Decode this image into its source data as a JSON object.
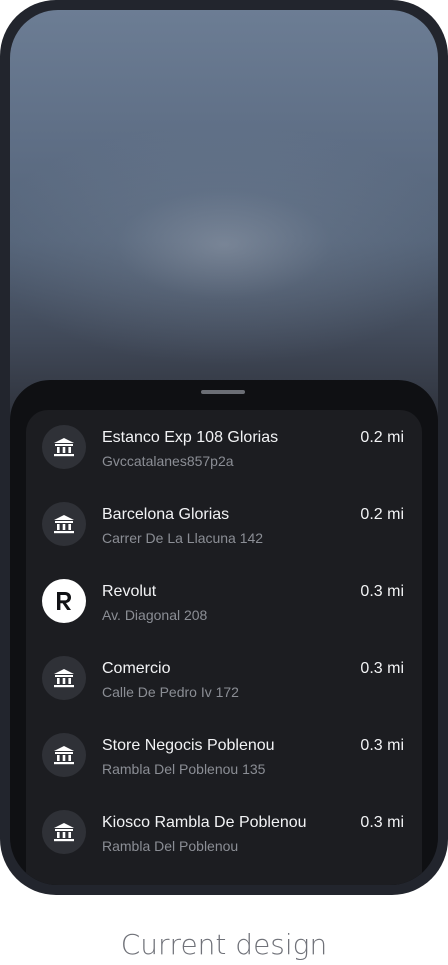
{
  "locations": [
    {
      "name": "Estanco Exp 108 Glorias",
      "address": "Gvccatalanes857p2a",
      "distance": "0.2 mi",
      "icon": "bank-icon"
    },
    {
      "name": "Barcelona Glorias",
      "address": "Carrer De La Llacuna 142",
      "distance": "0.2 mi",
      "icon": "bank-icon"
    },
    {
      "name": "Revolut",
      "address": "Av. Diagonal 208",
      "distance": "0.3 mi",
      "icon": "revolut-logo-icon"
    },
    {
      "name": "Comercio",
      "address": "Calle De Pedro Iv 172",
      "distance": "0.3 mi",
      "icon": "bank-icon"
    },
    {
      "name": "Store Negocis Poblenou",
      "address": "Rambla Del Poblenou 135",
      "distance": "0.3 mi",
      "icon": "bank-icon"
    },
    {
      "name": "Kiosco Rambla De Poblenou",
      "address": "Rambla Del Poblenou",
      "distance": "0.3 mi",
      "icon": "bank-icon"
    }
  ],
  "caption": "Current design",
  "colors": {
    "sheet_bg": "#0f1013",
    "card_bg": "#1c1d21",
    "icon_bg": "#2f3137",
    "primary_text": "#f2f3f5",
    "secondary_text": "#8b8e95"
  }
}
